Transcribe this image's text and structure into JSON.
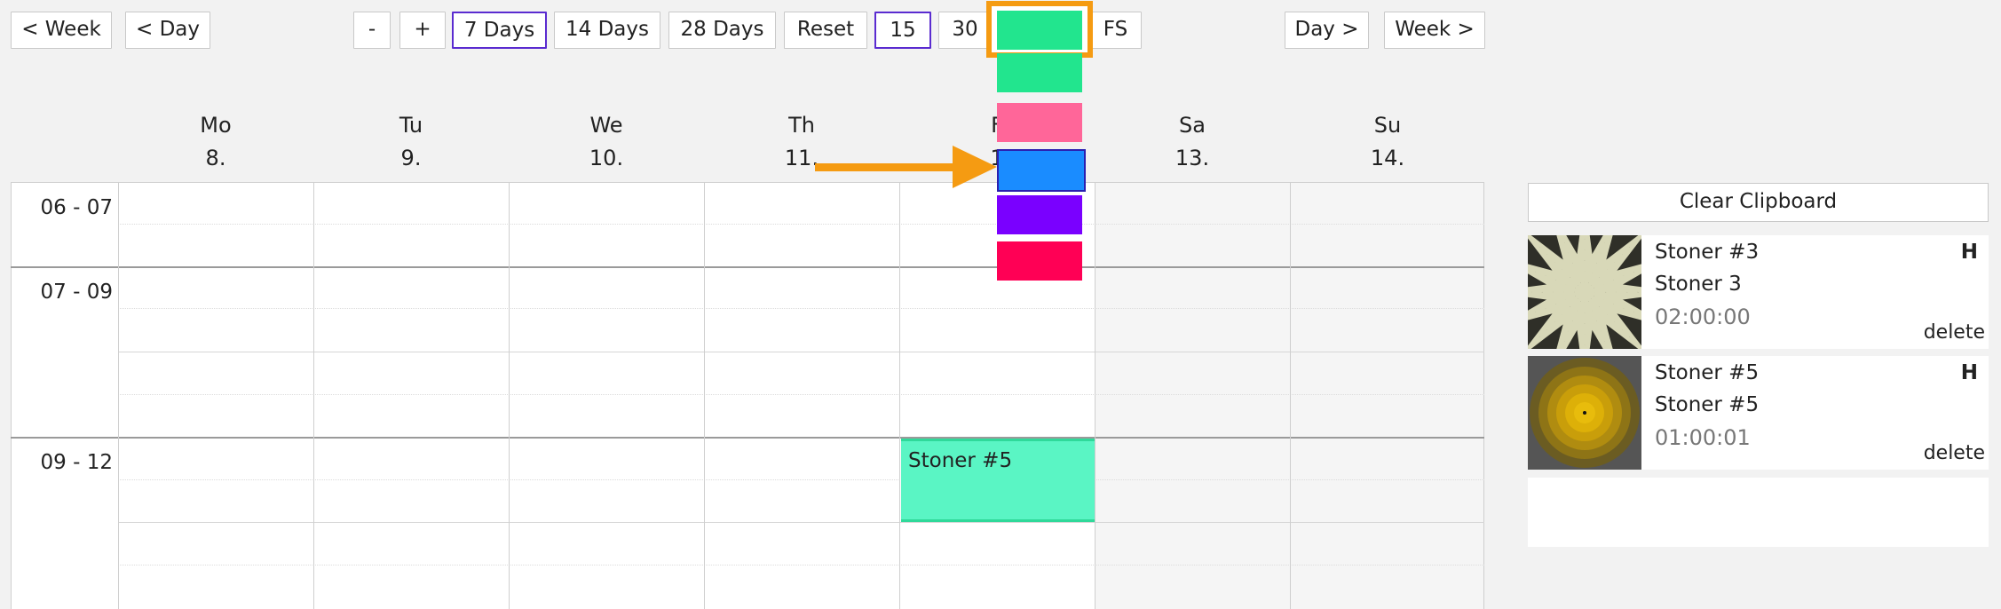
{
  "toolbar": {
    "week_prev": "< Week",
    "day_prev": "< Day",
    "zoom_out": "-",
    "zoom_in": "+",
    "days7": "7 Days",
    "days14": "14 Days",
    "days28": "28 Days",
    "reset": "Reset",
    "min15": "15",
    "min30": "30",
    "fs": "FS",
    "day_next": "Day >",
    "week_next": "Week >"
  },
  "color_picker": {
    "selected": "#22e58e",
    "options": [
      "#22e58e",
      "#ff6699",
      "#1a8cff",
      "#7a00ff",
      "#ff0055"
    ]
  },
  "days": [
    {
      "name": "Mo",
      "num": "8."
    },
    {
      "name": "Tu",
      "num": "9."
    },
    {
      "name": "We",
      "num": "10."
    },
    {
      "name": "Th",
      "num": "11."
    },
    {
      "name": "F",
      "num": "1"
    },
    {
      "name": "Sa",
      "num": "13."
    },
    {
      "name": "Su",
      "num": "14."
    }
  ],
  "time_groups": [
    "06 - 07",
    "07 - 09",
    "09 - 12"
  ],
  "event": {
    "title": "Stoner #5",
    "color": "#5af5c4"
  },
  "clipboard": {
    "clear_label": "Clear Clipboard",
    "items": [
      {
        "title": "Stoner #3",
        "subtitle": "Stoner 3",
        "duration": "02:00:00",
        "flag": "H",
        "delete": "delete",
        "thumb": "starburst"
      },
      {
        "title": "Stoner #5",
        "subtitle": "Stoner #5",
        "duration": "01:00:01",
        "flag": "H",
        "delete": "delete",
        "thumb": "rings"
      }
    ]
  },
  "colors": {
    "accent_purple": "#5a2bd0",
    "highlight_orange": "#f59b12"
  }
}
